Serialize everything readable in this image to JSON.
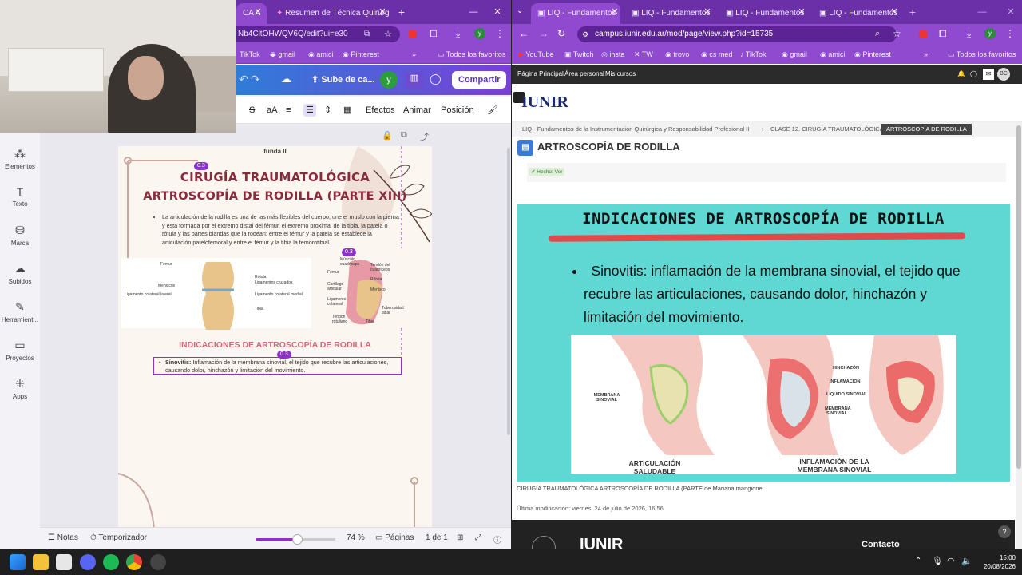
{
  "left_browser": {
    "tabs": [
      {
        "label": "CA A"
      },
      {
        "label": "Resumen de Técnica Quirúrgic"
      }
    ],
    "new_tab": "+",
    "window_min": "—",
    "window_max": "□",
    "window_close": "✕",
    "url": "Nb4CltOHWQV6Q/edit?ui=e30",
    "profile": "y",
    "bookmarks": [
      {
        "label": "TikTok"
      },
      {
        "label": "gmail"
      },
      {
        "label": "amici"
      },
      {
        "label": "Pinterest"
      }
    ],
    "bookmarks_more": "»",
    "favorites": "Todos los favoritos"
  },
  "canva": {
    "upload_label": "Sube de ca...",
    "avatar": "y",
    "share_label": "Compartir",
    "edit_toolbar": {
      "effects": "Efectos",
      "animate": "Animar",
      "position": "Posición",
      "text_size": "aA"
    },
    "sidebar": [
      {
        "label": "Elementos",
        "icon": "elements-icon"
      },
      {
        "label": "Texto",
        "icon": "text-icon"
      },
      {
        "label": "Marca",
        "icon": "brand-icon"
      },
      {
        "label": "Subidos",
        "icon": "uploads-icon"
      },
      {
        "label": "Herramient...",
        "icon": "tools-icon"
      },
      {
        "label": "Proyectos",
        "icon": "projects-icon"
      },
      {
        "label": "Apps",
        "icon": "apps-icon"
      }
    ],
    "page": {
      "header": "funda II",
      "title1": "CIRUGÍA TRAUMATOLÓGICA",
      "title2": "ARTROSCOPÍA DE RODILLA (PARTE XIII)",
      "paragraph": "La articulación de la rodilla es una de las más flexibles del cuerpo, une el muslo con la pierna y está formada por el extremo distal del fémur, el extremo proximal de la tibia, la patela o rótula y las partes blandas que la rodean: entre el fémur y la patela se establece la articulación patelofemoral y entre el fémur y la tibia la femorotibial.",
      "figure_labels": {
        "femur": "Fémur",
        "rotula": "Rótula",
        "lig_cruzados": "Ligamentos cruzados",
        "meniscos": "Meniscos",
        "lig_lateral": "Ligamento colateral lateral",
        "lig_medial": "Ligamento colateral medial",
        "tibia": "Tibia",
        "musculo": "Músculo cuadriceps",
        "tendon_cuad": "Tendón del cuadriceps",
        "femur2": "Fémur",
        "rotula2": "Rótula",
        "cartilago": "Cartílago articular",
        "menisco": "Menisco",
        "lig_colateral": "Ligamento colateral",
        "tendon_rot": "Tendón rotuliano",
        "tubero": "Tuberosidad tibial",
        "tibia2": "Tibia"
      },
      "section_title": "INDICACIONES DE ARTROSCOPÍA DE RODILLA",
      "bullet_label": "Sinovitis:",
      "bullet_text": "Inflamación de la membrana sinovial, el tejido que recubre las articulaciones, causando dolor, hinchazón y limitación del movimiento.",
      "badge1": "0.3",
      "badge2": "0.3",
      "badge3": "0.3"
    },
    "bottom": {
      "notes": "Notas",
      "timer": "Temporizador",
      "zoom": "74 %",
      "zoom_level": 0.74,
      "pages": "Páginas",
      "page_count": "1 de 1"
    }
  },
  "right_browser": {
    "tabs": [
      {
        "label": "LIQ - Fundamentos"
      },
      {
        "label": "LIQ - Fundamentos"
      },
      {
        "label": "LIQ - Fundamentos"
      },
      {
        "label": "LIQ - Fundamentos"
      }
    ],
    "new_tab": "+",
    "url": "campus.iunir.edu.ar/mod/page/view.php?id=15735",
    "profile": "y",
    "bookmarks": [
      {
        "label": "YouTube"
      },
      {
        "label": "Twitch"
      },
      {
        "label": "insta"
      },
      {
        "label": "TW"
      },
      {
        "label": "trovo"
      },
      {
        "label": "cs med"
      },
      {
        "label": "TikTok"
      },
      {
        "label": "gmail"
      },
      {
        "label": "amici"
      },
      {
        "label": "Pinterest"
      }
    ],
    "bookmarks_more": "»",
    "favorites": "Todos los favoritos"
  },
  "moodle": {
    "nav": [
      "Página Principal",
      "Área personal",
      "Mis cursos"
    ],
    "user_initials": "BC",
    "logo": "IUNIR",
    "breadcrumbs": [
      "LIQ - Fundamentos de la Instrumentación Quirúrgica y Responsabilidad Profesional II",
      "CLASE 12. CIRUGÍA TRAUMATOLÓGICA",
      "ARTROSCOPÍA DE RODILLA"
    ],
    "crumb_sep": "›",
    "page_title": "ARTROSCOPÍA DE RODILLA",
    "done_label": "✔ Hecho: Ver",
    "slide": {
      "heading": "INDICACIONES DE ARTROSCOPÍA DE RODILLA",
      "bullet": "Sinovitis: inflamación de la membrana sinovial, el tejido que recubre las articulaciones, causando dolor, hinchazón y limitación del movimiento.",
      "labels": {
        "membrana": "MEMBRANA SINOVIAL",
        "hinchazon": "HINCHAZÓN",
        "inflamacion": "INFLAMACIÓN",
        "liquido": "LÍQUIDO SINOVIAL",
        "membrana2": "MEMBRANA SINOVIAL",
        "saludable": "ARTICULACIÓN SALUDABLE",
        "inflamada": "INFLAMACIÓN DE LA MEMBRANA SINOVIAL"
      }
    },
    "caption_title": "CIRUGÍA TRAUMATOLÓGICA ARTROSCOPÍA DE RODILLA (PARTE",
    "caption_rest": "de Mariana mangione",
    "modified": "Última modificación: viernes, 24 de julio de 2026, 16:56",
    "footer_contact": "Contacto",
    "footer_logo": "IUNIR",
    "help": "?"
  },
  "taskbar": {
    "time": "15:00",
    "date": "20/08/2026"
  },
  "colors": {
    "browser_purple": "#8f4ad0",
    "tab_purple": "#6b2fa8",
    "slide_bg": "#5fd7d2",
    "title_red": "#8a2a3c",
    "accent": "#8e2fd0"
  }
}
